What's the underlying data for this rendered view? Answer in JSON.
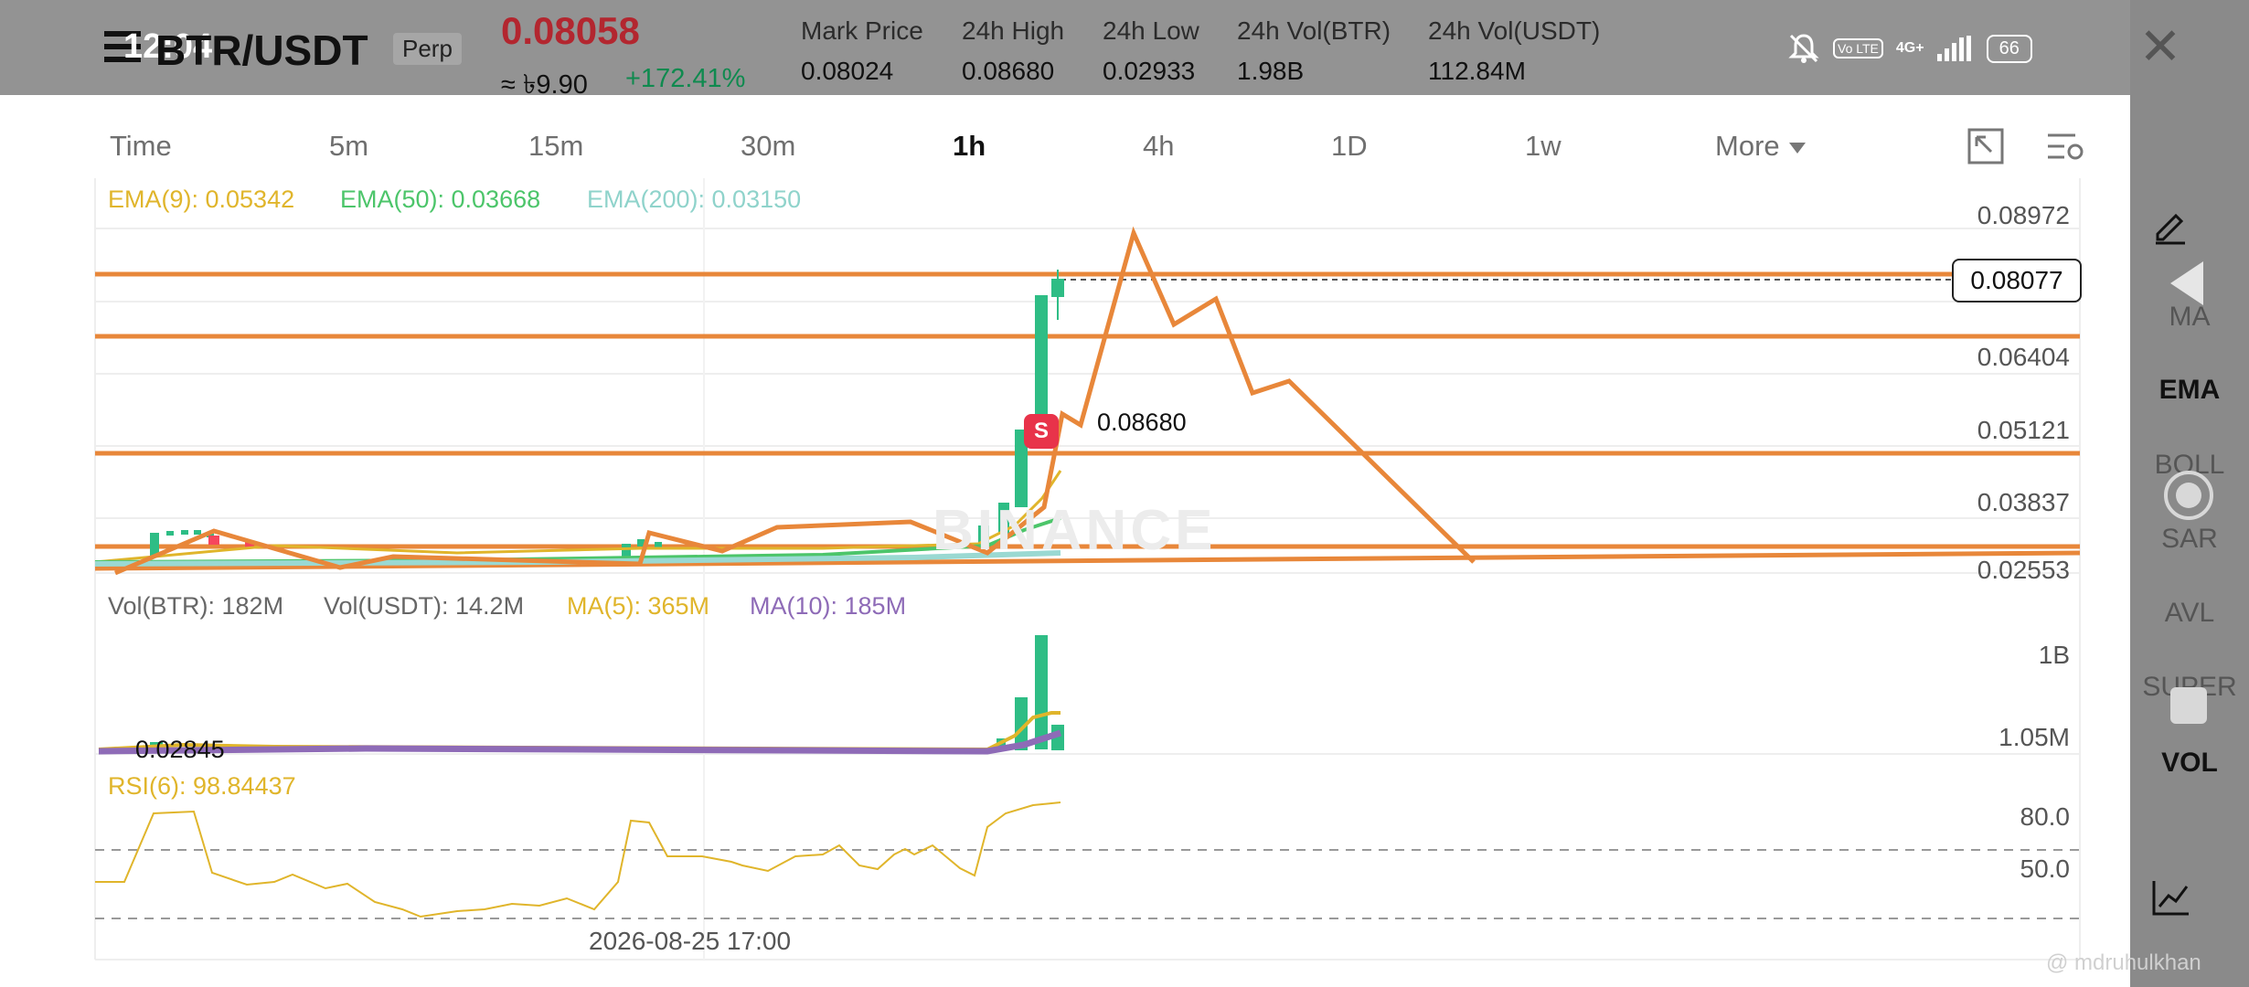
{
  "header": {
    "status_time": "12:04",
    "symbol": "BTR/USDT",
    "contract_type": "Perp",
    "last_price": "0.08058",
    "approx_local": "≈ ৳9.90",
    "change_pct": "+172.41%",
    "stats": [
      {
        "label": "Mark Price",
        "value": "0.08024"
      },
      {
        "label": "24h High",
        "value": "0.08680"
      },
      {
        "label": "24h Low",
        "value": "0.02933"
      },
      {
        "label": "24h Vol(BTR)",
        "value": "1.98B"
      },
      {
        "label": "24h Vol(USDT)",
        "value": "112.84M"
      }
    ],
    "status_bar": {
      "volte": "Vo LTE",
      "network": "4G+",
      "battery": "66"
    }
  },
  "intervals": {
    "items": [
      "Time",
      "5m",
      "15m",
      "30m",
      "1h",
      "4h",
      "1D",
      "1w"
    ],
    "active": "1h",
    "more_label": "More"
  },
  "indicators_panel": {
    "items": [
      "MA",
      "EMA",
      "BOLL",
      "SAR",
      "AVL",
      "SUPER",
      "VOL"
    ],
    "active": [
      "EMA",
      "VOL"
    ]
  },
  "main_chart": {
    "ema_legend": [
      {
        "label": "EMA(9): 0.05342",
        "color": "#e0b52b"
      },
      {
        "label": "EMA(50): 0.03668",
        "color": "#4cc56a"
      },
      {
        "label": "EMA(200): 0.03150",
        "color": "#9ad9d2"
      }
    ],
    "price_axis": [
      "0.08972",
      "0.06404",
      "0.05121",
      "0.03837",
      "0.02553"
    ],
    "current_price_tag": "0.08077",
    "high_marker_label": "0.08680",
    "low_marker_label": "0.02845",
    "signal_marker": "S",
    "watermark": "BINANCE",
    "drawing_color": "#e8873a"
  },
  "volume_chart": {
    "legend": [
      {
        "label": "Vol(BTR): 182M",
        "color": "#666666"
      },
      {
        "label": "Vol(USDT): 14.2M",
        "color": "#666666"
      },
      {
        "label": "MA(5): 365M",
        "color": "#e0b52b"
      },
      {
        "label": "MA(10): 185M",
        "color": "#8e6bb7"
      }
    ],
    "axis": [
      "1B",
      "1.05M"
    ]
  },
  "rsi_chart": {
    "legend": "RSI(6): 98.84437",
    "axis": [
      "80.0",
      "50.0"
    ]
  },
  "time_axis_label": "2026-08-25 17:00",
  "credit": "@ mdruhulkhan"
}
